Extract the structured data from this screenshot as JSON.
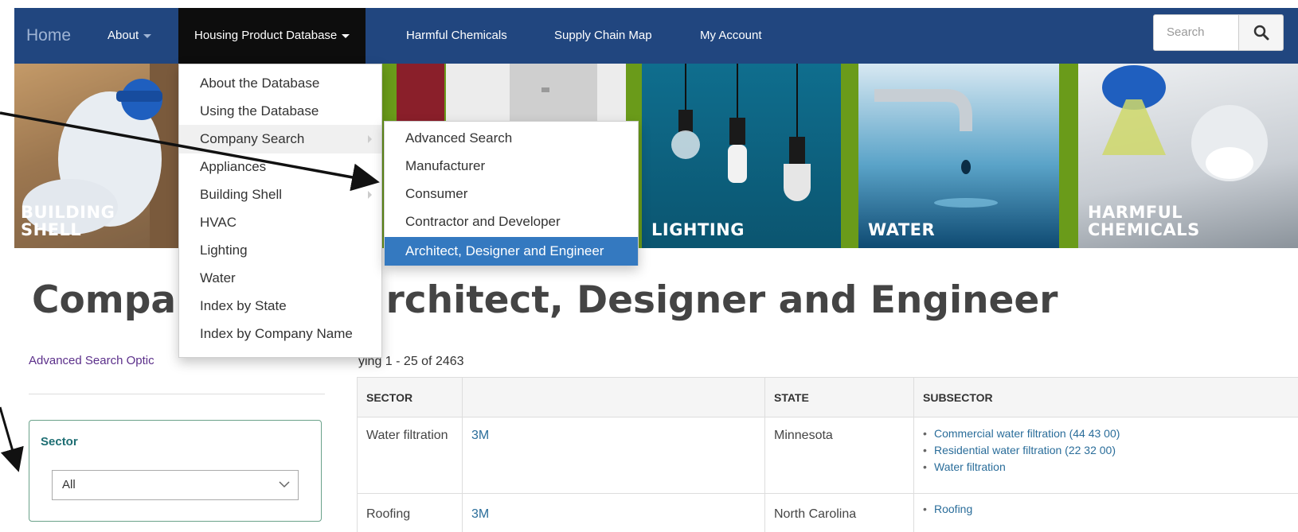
{
  "nav": {
    "home": "Home",
    "about": "About",
    "database": "Housing Product Database",
    "chemicals": "Harmful Chemicals",
    "supply_chain": "Supply Chain Map",
    "account": "My Account",
    "search_placeholder": "Search"
  },
  "banner": {
    "tiles": [
      "BUILDING SHELL",
      "LIGHTING",
      "WATER",
      "HARMFUL CHEMICALS"
    ]
  },
  "db_menu": {
    "items": [
      "About the Database",
      "Using the Database",
      "Company Search",
      "Appliances",
      "Building Shell",
      "HVAC",
      "Lighting",
      "Water",
      "Index by State",
      "Index by Company Name"
    ]
  },
  "company_submenu": {
    "items": [
      "Advanced Search",
      "Manufacturer",
      "Consumer",
      "Contractor and Developer",
      "Architect, Designer and Engineer"
    ],
    "selected": "Architect, Designer and Engineer"
  },
  "page": {
    "title": "Companies: Architect, Designer and Engineer",
    "title_left": "Compan",
    "title_right": "rchitect, Designer and Engineer",
    "advanced_link": "Advanced Search Optic",
    "displaying": "ying 1 - 25 of 2463"
  },
  "filter": {
    "sector_label": "Sector",
    "sector_value": "All"
  },
  "table": {
    "headers": [
      "SECTOR",
      "",
      "STATE",
      "SUBSECTOR"
    ],
    "rows": [
      {
        "sector": "Water filtration",
        "company": "3M",
        "state": "Minnesota",
        "subsectors": [
          "Commercial water filtration (44 43 00)",
          "Residential water filtration (22 32 00)",
          "Water filtration"
        ]
      },
      {
        "sector": "Roofing",
        "company": "3M",
        "state": "North Carolina",
        "subsectors": [
          "Roofing"
        ]
      }
    ]
  },
  "colors": {
    "navbar": "#21467f",
    "active_nav": "#0d0d0d",
    "banner_green": "#6a9b1a",
    "selected_item": "#3479c0",
    "link": "#2a6d9a"
  }
}
